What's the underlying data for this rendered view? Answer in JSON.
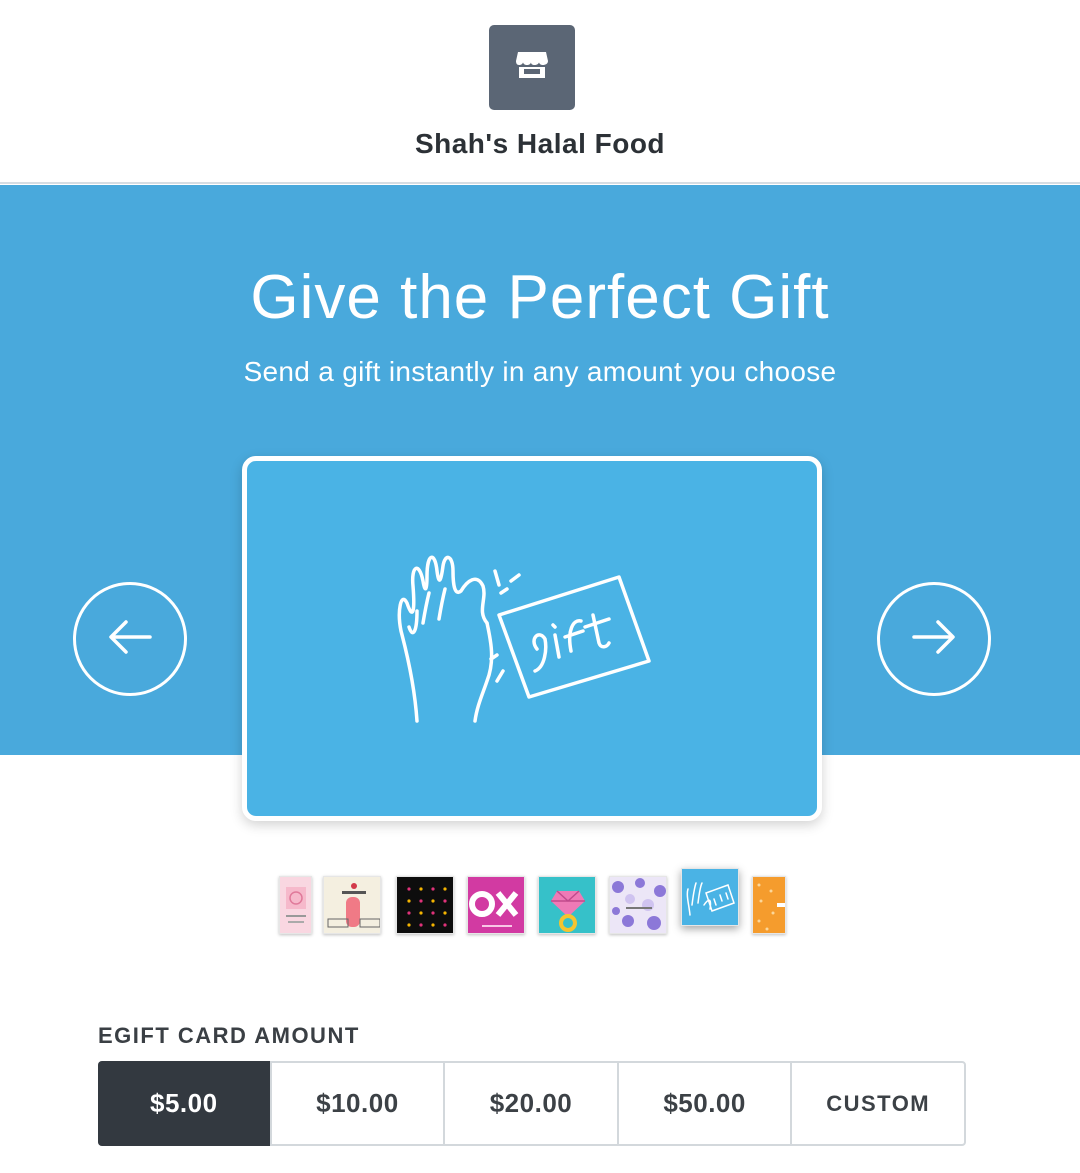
{
  "store": {
    "name": "Shah's Halal Food",
    "logo_icon": "storefront-icon",
    "logo_color": "#5b6675"
  },
  "hero": {
    "title": "Give the Perfect Gift",
    "subtitle": "Send a gift instantly in any amount you choose",
    "background_color": "#49a9dc",
    "prev_icon": "arrow-left-icon",
    "next_icon": "arrow-right-icon"
  },
  "card": {
    "design": "hand-giving-gift-card",
    "card_text": "gift",
    "background_color": "#4ab3e5"
  },
  "thumbnails": [
    {
      "name": "pink-design",
      "color": "#f7c9d6"
    },
    {
      "name": "i-love-you-design",
      "color": "#f4efe0"
    },
    {
      "name": "dots-black-design",
      "color": "#111111"
    },
    {
      "name": "xo-magenta-design",
      "color": "#d23aa2"
    },
    {
      "name": "ring-turquoise-design",
      "color": "#36c1c9"
    },
    {
      "name": "congrats-hearts-design",
      "color": "#ece6f7"
    },
    {
      "name": "gift-blue-design",
      "color": "#4ab3e5",
      "selected": true
    },
    {
      "name": "orange-gift-design",
      "color": "#f59c2d"
    }
  ],
  "amount": {
    "label": "EGIFT CARD AMOUNT",
    "options": [
      "$5.00",
      "$10.00",
      "$20.00",
      "$50.00",
      "CUSTOM"
    ],
    "selected": "$5.00",
    "selected_color": "#333940"
  }
}
